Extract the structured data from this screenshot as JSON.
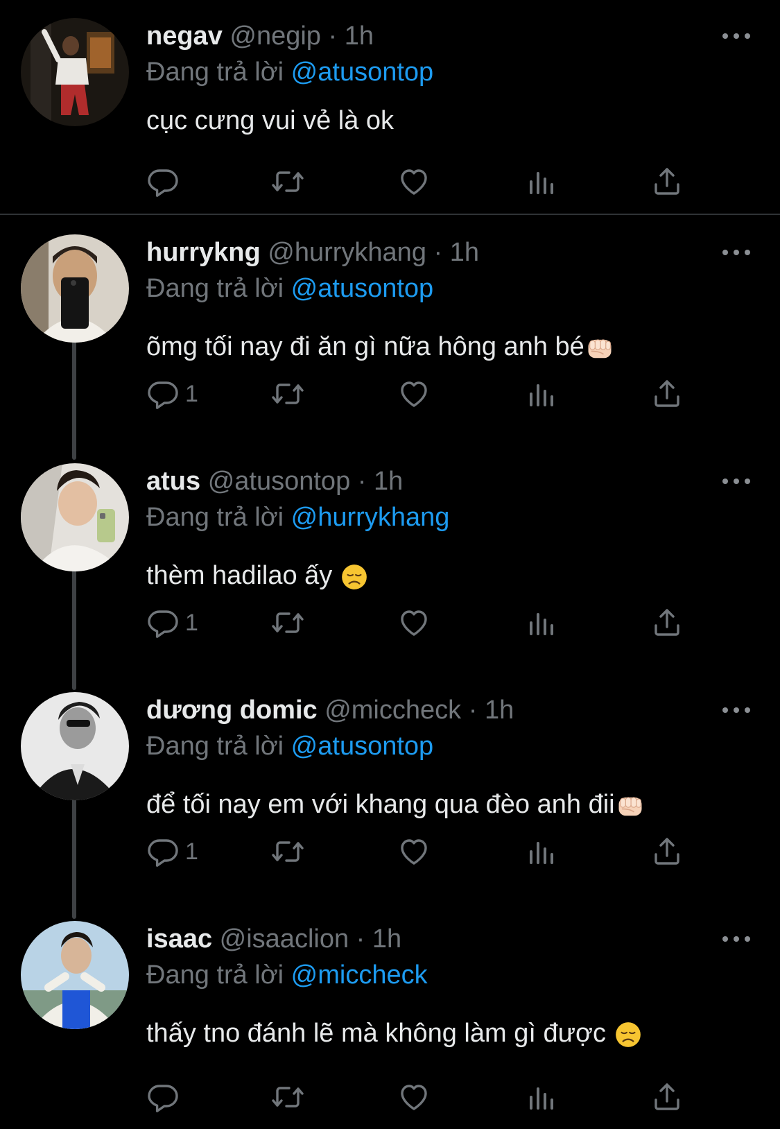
{
  "reply_prefix": "Đang trả lời",
  "colors": {
    "background": "#000000",
    "text": "#e7e9ea",
    "muted": "#71767b",
    "mention": "#1d9bf0",
    "divider": "#2f3336",
    "thread_line": "#3e4144"
  },
  "tweets": [
    {
      "display_name": "negav",
      "handle": "@negip",
      "separator": "·",
      "time": "1h",
      "reply_to": "@atusontop",
      "text": "cục cưng vui vẻ là ok",
      "reply_count": "",
      "trailing_emoji": ""
    },
    {
      "display_name": "hurrykng",
      "handle": "@hurrykhang",
      "separator": "·",
      "time": "1h",
      "reply_to": "@atusontop",
      "text": "õmg tối nay đi ăn gì nữa hông anh bé",
      "reply_count": "1",
      "trailing_emoji": "fist-icon"
    },
    {
      "display_name": "atus",
      "handle": "@atusontop",
      "separator": "·",
      "time": "1h",
      "reply_to": "@hurrykhang",
      "text": "thèm hadilao ấy ",
      "reply_count": "1",
      "trailing_emoji": "disappointed-face-icon"
    },
    {
      "display_name": "dương domic",
      "handle": "@miccheck",
      "separator": "·",
      "time": "1h",
      "reply_to": "@atusontop",
      "text": "để tối nay em với khang qua đèo anh đii",
      "reply_count": "1",
      "trailing_emoji": "fist-icon"
    },
    {
      "display_name": "isaac",
      "handle": "@isaaclion",
      "separator": "·",
      "time": "1h",
      "reply_to": "@miccheck",
      "text": "thấy tno đánh lẽ mà không làm gì được ",
      "reply_count": "",
      "trailing_emoji": "disappointed-face-icon"
    }
  ]
}
